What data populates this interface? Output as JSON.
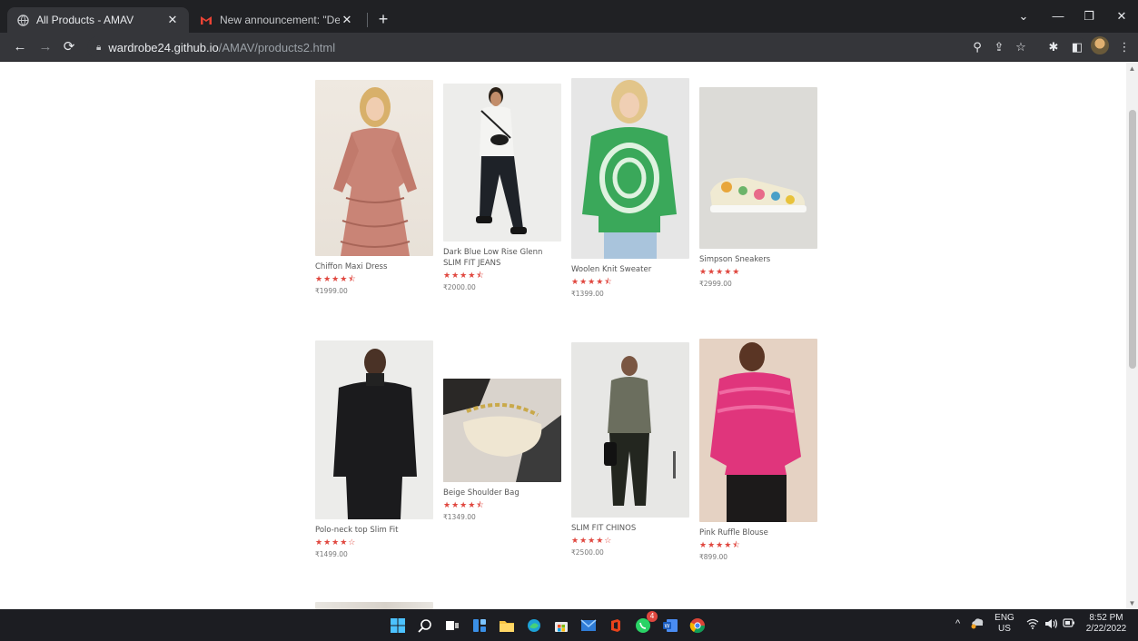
{
  "browser": {
    "tabs": [
      {
        "title": "All Products - AMAV",
        "active": true,
        "icon": "globe-icon"
      },
      {
        "title": "New announcement: \"Dear stude",
        "active": false,
        "icon": "gmail-icon"
      }
    ],
    "url_host": "wardrobe24.github.io",
    "url_path": "/AMAV/products2.html"
  },
  "products": [
    {
      "name": "Chiffon Maxi Dress",
      "rating": 4.5,
      "stars": "★★★★⯪",
      "price": "₹1999.00",
      "image": "woman-in-pink-ruffled-dress"
    },
    {
      "name": "Dark Blue Low Rise Glenn SLIM FIT JEANS",
      "rating": 4.5,
      "stars": "★★★★⯪",
      "price": "₹2000.00",
      "image": "man-walking-in-jeans"
    },
    {
      "name": "Woolen Knit Sweater",
      "rating": 4.5,
      "stars": "★★★★⯪",
      "price": "₹1399.00",
      "image": "woman-in-green-sweater"
    },
    {
      "name": "Simpson Sneakers",
      "rating": 5,
      "stars": "★★★★★",
      "price": "₹2999.00",
      "image": "floral-sneaker"
    },
    {
      "name": "Polo-neck top Slim Fit",
      "rating": 4,
      "stars": "★★★★☆",
      "price": "₹1499.00",
      "image": "man-in-black-polo-neck"
    },
    {
      "name": "Beige Shoulder Bag",
      "rating": 4.5,
      "stars": "★★★★⯪",
      "price": "₹1349.00",
      "image": "beige-bag-with-chain"
    },
    {
      "name": "SLIM FIT CHINOS",
      "rating": 4,
      "stars": "★★★★☆",
      "price": "₹2500.00",
      "image": "man-in-chinos"
    },
    {
      "name": "Pink Ruffle Blouse",
      "rating": 4.5,
      "stars": "★★★★⯪",
      "price": "₹899.00",
      "image": "woman-in-pink-blouse"
    }
  ],
  "taskbar": {
    "language": "ENG",
    "region": "US",
    "time": "8:52 PM",
    "date": "2/22/2022",
    "whatsapp_badge": "4"
  },
  "colors": {
    "star": "#e0473f",
    "chrome_dark": "#202124",
    "chrome_toolbar": "#35363a"
  }
}
